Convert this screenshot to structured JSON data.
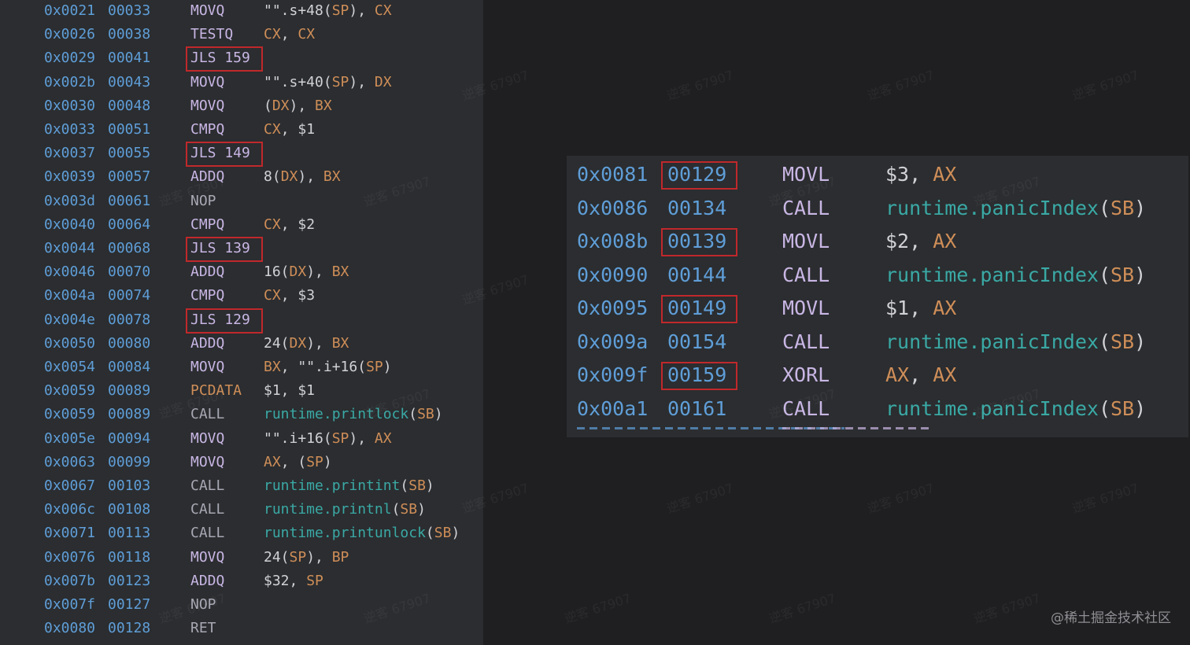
{
  "left_listing": {
    "rows": [
      {
        "addr": "0x0021",
        "offset": "00033",
        "op": "MOVQ",
        "op_style": "normal",
        "highlight_op": false,
        "args": [
          {
            "t": "\"\".s+48(",
            "k": "text"
          },
          {
            "t": "SP",
            "k": "reg"
          },
          {
            "t": "), ",
            "k": "text"
          },
          {
            "t": "CX",
            "k": "reg"
          }
        ]
      },
      {
        "addr": "0x0026",
        "offset": "00038",
        "op": "TESTQ",
        "op_style": "normal",
        "highlight_op": false,
        "args": [
          {
            "t": "CX",
            "k": "reg"
          },
          {
            "t": ", ",
            "k": "text"
          },
          {
            "t": "CX",
            "k": "reg"
          }
        ]
      },
      {
        "addr": "0x0029",
        "offset": "00041",
        "op": "JLS 159",
        "op_style": "normal",
        "highlight_op": true,
        "args": []
      },
      {
        "addr": "0x002b",
        "offset": "00043",
        "op": "MOVQ",
        "op_style": "normal",
        "highlight_op": false,
        "args": [
          {
            "t": "\"\".s+40(",
            "k": "text"
          },
          {
            "t": "SP",
            "k": "reg"
          },
          {
            "t": "), ",
            "k": "text"
          },
          {
            "t": "DX",
            "k": "reg"
          }
        ]
      },
      {
        "addr": "0x0030",
        "offset": "00048",
        "op": "MOVQ",
        "op_style": "normal",
        "highlight_op": false,
        "args": [
          {
            "t": "(",
            "k": "text"
          },
          {
            "t": "DX",
            "k": "reg"
          },
          {
            "t": "), ",
            "k": "text"
          },
          {
            "t": "BX",
            "k": "reg"
          }
        ]
      },
      {
        "addr": "0x0033",
        "offset": "00051",
        "op": "CMPQ",
        "op_style": "normal",
        "highlight_op": false,
        "args": [
          {
            "t": "CX",
            "k": "reg"
          },
          {
            "t": ", $1",
            "k": "text"
          }
        ]
      },
      {
        "addr": "0x0037",
        "offset": "00055",
        "op": "JLS 149",
        "op_style": "normal",
        "highlight_op": true,
        "args": []
      },
      {
        "addr": "0x0039",
        "offset": "00057",
        "op": "ADDQ",
        "op_style": "normal",
        "highlight_op": false,
        "args": [
          {
            "t": "8(",
            "k": "text"
          },
          {
            "t": "DX",
            "k": "reg"
          },
          {
            "t": "), ",
            "k": "text"
          },
          {
            "t": "BX",
            "k": "reg"
          }
        ]
      },
      {
        "addr": "0x003d",
        "offset": "00061",
        "op": "NOP",
        "op_style": "dim",
        "highlight_op": false,
        "args": []
      },
      {
        "addr": "0x0040",
        "offset": "00064",
        "op": "CMPQ",
        "op_style": "normal",
        "highlight_op": false,
        "args": [
          {
            "t": "CX",
            "k": "reg"
          },
          {
            "t": ", $2",
            "k": "text"
          }
        ]
      },
      {
        "addr": "0x0044",
        "offset": "00068",
        "op": "JLS 139",
        "op_style": "normal",
        "highlight_op": true,
        "args": []
      },
      {
        "addr": "0x0046",
        "offset": "00070",
        "op": "ADDQ",
        "op_style": "normal",
        "highlight_op": false,
        "args": [
          {
            "t": "16(",
            "k": "text"
          },
          {
            "t": "DX",
            "k": "reg"
          },
          {
            "t": "), ",
            "k": "text"
          },
          {
            "t": "BX",
            "k": "reg"
          }
        ]
      },
      {
        "addr": "0x004a",
        "offset": "00074",
        "op": "CMPQ",
        "op_style": "normal",
        "highlight_op": false,
        "args": [
          {
            "t": "CX",
            "k": "reg"
          },
          {
            "t": ", $3",
            "k": "text"
          }
        ]
      },
      {
        "addr": "0x004e",
        "offset": "00078",
        "op": "JLS 129",
        "op_style": "normal",
        "highlight_op": true,
        "args": []
      },
      {
        "addr": "0x0050",
        "offset": "00080",
        "op": "ADDQ",
        "op_style": "normal",
        "highlight_op": false,
        "args": [
          {
            "t": "24(",
            "k": "text"
          },
          {
            "t": "DX",
            "k": "reg"
          },
          {
            "t": "), ",
            "k": "text"
          },
          {
            "t": "BX",
            "k": "reg"
          }
        ]
      },
      {
        "addr": "0x0054",
        "offset": "00084",
        "op": "MOVQ",
        "op_style": "normal",
        "highlight_op": false,
        "args": [
          {
            "t": "BX",
            "k": "reg"
          },
          {
            "t": ", \"\".i+16(",
            "k": "text"
          },
          {
            "t": "SP",
            "k": "reg"
          },
          {
            "t": ")",
            "k": "text"
          }
        ]
      },
      {
        "addr": "0x0059",
        "offset": "00089",
        "op": "PCDATA",
        "op_style": "accent",
        "highlight_op": false,
        "args": [
          {
            "t": "$1, $1",
            "k": "text"
          }
        ]
      },
      {
        "addr": "0x0059",
        "offset": "00089",
        "op": "CALL",
        "op_style": "dim",
        "highlight_op": false,
        "args": [
          {
            "t": "runtime.printlock",
            "k": "fn"
          },
          {
            "t": "(",
            "k": "text"
          },
          {
            "t": "SB",
            "k": "reg"
          },
          {
            "t": ")",
            "k": "text"
          }
        ]
      },
      {
        "addr": "0x005e",
        "offset": "00094",
        "op": "MOVQ",
        "op_style": "normal",
        "highlight_op": false,
        "args": [
          {
            "t": "\"\".i+16(",
            "k": "text"
          },
          {
            "t": "SP",
            "k": "reg"
          },
          {
            "t": "), ",
            "k": "text"
          },
          {
            "t": "AX",
            "k": "reg"
          }
        ]
      },
      {
        "addr": "0x0063",
        "offset": "00099",
        "op": "MOVQ",
        "op_style": "normal",
        "highlight_op": false,
        "args": [
          {
            "t": "AX",
            "k": "reg"
          },
          {
            "t": ", (",
            "k": "text"
          },
          {
            "t": "SP",
            "k": "reg"
          },
          {
            "t": ")",
            "k": "text"
          }
        ]
      },
      {
        "addr": "0x0067",
        "offset": "00103",
        "op": "CALL",
        "op_style": "dim",
        "highlight_op": false,
        "args": [
          {
            "t": "runtime.printint",
            "k": "fn"
          },
          {
            "t": "(",
            "k": "text"
          },
          {
            "t": "SB",
            "k": "reg"
          },
          {
            "t": ")",
            "k": "text"
          }
        ]
      },
      {
        "addr": "0x006c",
        "offset": "00108",
        "op": "CALL",
        "op_style": "dim",
        "highlight_op": false,
        "args": [
          {
            "t": "runtime.printnl",
            "k": "fn"
          },
          {
            "t": "(",
            "k": "text"
          },
          {
            "t": "SB",
            "k": "reg"
          },
          {
            "t": ")",
            "k": "text"
          }
        ]
      },
      {
        "addr": "0x0071",
        "offset": "00113",
        "op": "CALL",
        "op_style": "dim",
        "highlight_op": false,
        "args": [
          {
            "t": "runtime.printunlock",
            "k": "fn"
          },
          {
            "t": "(",
            "k": "text"
          },
          {
            "t": "SB",
            "k": "reg"
          },
          {
            "t": ")",
            "k": "text"
          }
        ]
      },
      {
        "addr": "0x0076",
        "offset": "00118",
        "op": "MOVQ",
        "op_style": "normal",
        "highlight_op": false,
        "args": [
          {
            "t": "24(",
            "k": "text"
          },
          {
            "t": "SP",
            "k": "reg"
          },
          {
            "t": "), ",
            "k": "text"
          },
          {
            "t": "BP",
            "k": "reg"
          }
        ]
      },
      {
        "addr": "0x007b",
        "offset": "00123",
        "op": "ADDQ",
        "op_style": "normal",
        "highlight_op": false,
        "args": [
          {
            "t": "$32, ",
            "k": "text"
          },
          {
            "t": "SP",
            "k": "reg"
          }
        ]
      },
      {
        "addr": "0x007f",
        "offset": "00127",
        "op": "NOP",
        "op_style": "dim",
        "highlight_op": false,
        "args": []
      },
      {
        "addr": "0x0080",
        "offset": "00128",
        "op": "RET",
        "op_style": "dim",
        "highlight_op": false,
        "args": []
      }
    ]
  },
  "right_listing": {
    "rows": [
      {
        "addr": "0x0081",
        "offset": "00129",
        "highlight_offset": true,
        "op": "MOVL",
        "args": [
          {
            "t": "$3, ",
            "k": "text"
          },
          {
            "t": "AX",
            "k": "reg"
          }
        ]
      },
      {
        "addr": "0x0086",
        "offset": "00134",
        "highlight_offset": false,
        "op": "CALL",
        "args": [
          {
            "t": "runtime.panicIndex",
            "k": "fn"
          },
          {
            "t": "(",
            "k": "text"
          },
          {
            "t": "SB",
            "k": "reg"
          },
          {
            "t": ")",
            "k": "text"
          }
        ]
      },
      {
        "addr": "0x008b",
        "offset": "00139",
        "highlight_offset": true,
        "op": "MOVL",
        "args": [
          {
            "t": "$2, ",
            "k": "text"
          },
          {
            "t": "AX",
            "k": "reg"
          }
        ]
      },
      {
        "addr": "0x0090",
        "offset": "00144",
        "highlight_offset": false,
        "op": "CALL",
        "args": [
          {
            "t": "runtime.panicIndex",
            "k": "fn"
          },
          {
            "t": "(",
            "k": "text"
          },
          {
            "t": "SB",
            "k": "reg"
          },
          {
            "t": ")",
            "k": "text"
          }
        ]
      },
      {
        "addr": "0x0095",
        "offset": "00149",
        "highlight_offset": true,
        "op": "MOVL",
        "args": [
          {
            "t": "$1, ",
            "k": "text"
          },
          {
            "t": "AX",
            "k": "reg"
          }
        ]
      },
      {
        "addr": "0x009a",
        "offset": "00154",
        "highlight_offset": false,
        "op": "CALL",
        "args": [
          {
            "t": "runtime.panicIndex",
            "k": "fn"
          },
          {
            "t": "(",
            "k": "text"
          },
          {
            "t": "SB",
            "k": "reg"
          },
          {
            "t": ")",
            "k": "text"
          }
        ]
      },
      {
        "addr": "0x009f",
        "offset": "00159",
        "highlight_offset": true,
        "op": "XORL",
        "args": [
          {
            "t": "AX",
            "k": "reg"
          },
          {
            "t": ", ",
            "k": "text"
          },
          {
            "t": "AX",
            "k": "reg"
          }
        ]
      },
      {
        "addr": "0x00a1",
        "offset": "00161",
        "highlight_offset": false,
        "op": "CALL",
        "args": [
          {
            "t": "runtime.panicIndex",
            "k": "fn"
          },
          {
            "t": "(",
            "k": "text"
          },
          {
            "t": "SB",
            "k": "reg"
          },
          {
            "t": ")",
            "k": "text"
          }
        ]
      }
    ]
  },
  "watermark": {
    "site_label": "@稀土掘金技术社区",
    "tile_text": "逆客 67907"
  },
  "colors": {
    "highlight_box": "#c0282b",
    "address": "#5f9ed8",
    "mnemonic": "#c9b6e4",
    "register": "#cf8e58",
    "function": "#3aa9a5"
  }
}
